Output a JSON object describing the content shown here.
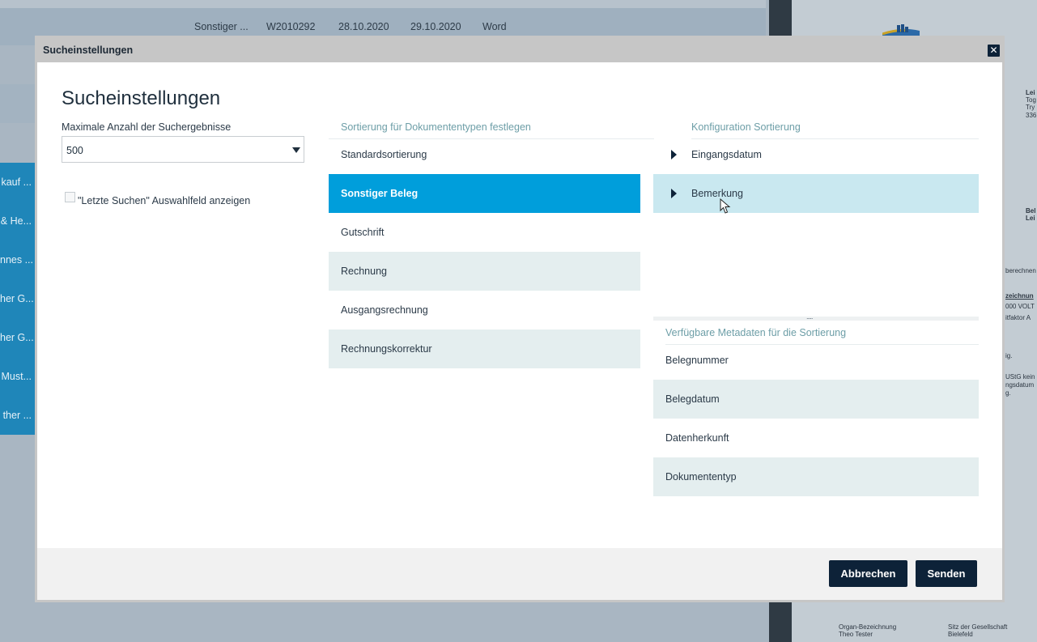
{
  "background": {
    "row": {
      "col1": "Sonstiger ...",
      "col2": "W2010292",
      "col3": "28.10.2020",
      "col4": "29.10.2020",
      "col5": "Word"
    },
    "sidebar": [
      "kauf ...",
      "& He...",
      "nnes ...",
      "her G...",
      "her G...",
      "Must...",
      "ther ..."
    ],
    "doc": {
      "t1": "Lei",
      "t2": "Tog",
      "t3": "Try",
      "t4": "336",
      "t5": "Bel",
      "t6": "Lei",
      "t7": "berechnen",
      "t8": "zeichnun",
      "t9": "000 VOLT",
      "t10": "itfaktor A",
      "t11": "ig.",
      "t12": "UStG kein",
      "t13": "ngsdatum",
      "t14": "g.",
      "footer_l1": "Organ-Bezeichnung",
      "footer_l2": "Theo Tester",
      "footer_r1": "Sitz der Gesellschaft",
      "footer_r2": "Bielefeld"
    }
  },
  "modal": {
    "header_title": "Sucheinstellungen",
    "close_label": "✕",
    "heading": "Sucheinstellungen",
    "max_results_label": "Maximale Anzahl der Suchergebnisse",
    "max_results_value": "500",
    "recent_search_checkbox_label": "\"Letzte Suchen\" Auswahlfeld anzeigen",
    "recent_search_checked": false,
    "doc_types": {
      "header": "Sortierung für Dokumententypen festlegen",
      "items": [
        "Standardsortierung",
        "Sonstiger Beleg",
        "Gutschrift",
        "Rechnung",
        "Ausgangsrechnung",
        "Rechnungskorrektur"
      ],
      "selected": "Sonstiger Beleg"
    },
    "sort_config": {
      "header": "Konfiguration Sortierung",
      "items": [
        "Eingangsdatum",
        "Bemerkung"
      ],
      "highlighted": "Bemerkung"
    },
    "splitter_grip": ".....",
    "metadata": {
      "header": "Verfügbare Metadaten für die Sortierung",
      "items": [
        "Belegnummer",
        "Belegdatum",
        "Datenherkunft",
        "Dokumententyp"
      ]
    },
    "buttons": {
      "cancel": "Abbrechen",
      "send": "Senden"
    }
  },
  "colors": {
    "selected": "#009edb",
    "highlight": "#c9e8f0",
    "alt_row": "#e4eeef",
    "button": "#0d2238",
    "section_header": "#6d9ea7"
  }
}
